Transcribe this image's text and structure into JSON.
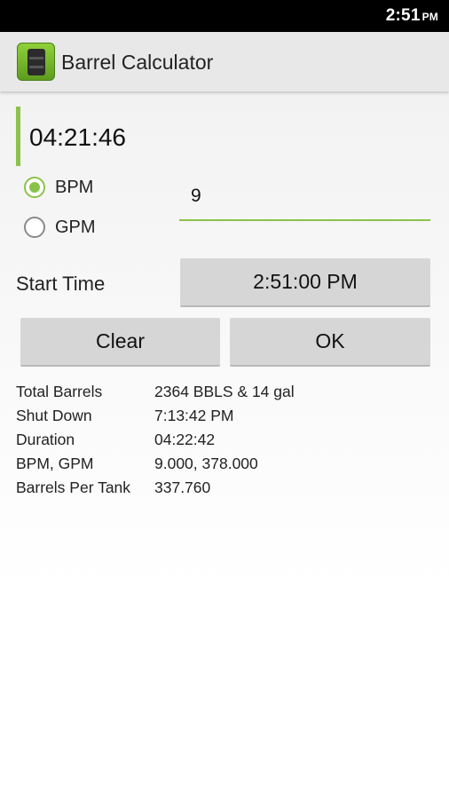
{
  "status_bar": {
    "time": "2:51",
    "ampm": "PM"
  },
  "app": {
    "title": "Barrel Calculator",
    "icon": "barrel-icon"
  },
  "timer": {
    "value": "04:21:46"
  },
  "rate_unit": {
    "options": [
      {
        "label": "BPM",
        "checked": true
      },
      {
        "label": "GPM",
        "checked": false
      }
    ]
  },
  "rate_input": {
    "value": "9"
  },
  "start_time": {
    "label": "Start Time",
    "value": "2:51:00 PM"
  },
  "buttons": {
    "clear": "Clear",
    "ok": "OK"
  },
  "results": [
    {
      "label": "Total Barrels",
      "value": "2364 BBLS & 14 gal"
    },
    {
      "label": "Shut Down",
      "value": "7:13:42 PM"
    },
    {
      "label": "Duration",
      "value": "04:22:42"
    },
    {
      "label": "BPM, GPM",
      "value": "9.000, 378.000"
    },
    {
      "label": "Barrels Per Tank",
      "value": "337.760"
    }
  ],
  "colors": {
    "accent": "#8bc34a",
    "action_bar": "#e8e8e8",
    "status_bar": "#000000"
  }
}
